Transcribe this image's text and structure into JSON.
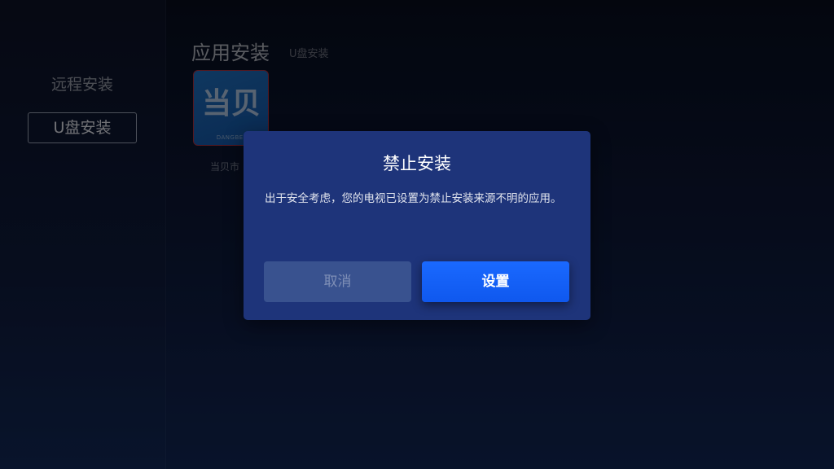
{
  "sidebar": {
    "items": [
      {
        "label": "远程安装",
        "selected": false
      },
      {
        "label": "U盘安装",
        "selected": true
      }
    ]
  },
  "main": {
    "title": "应用安装",
    "subtitle": "U盘安装",
    "apps": [
      {
        "name": "当贝市",
        "icon_text": "当贝",
        "icon_caption": "DANGBEI"
      }
    ]
  },
  "dialog": {
    "title": "禁止安装",
    "message": "出于安全考虑，您的电视已设置为禁止安装来源不明的应用。",
    "cancel_label": "取消",
    "settings_label": "设置"
  },
  "colors": {
    "dialog_bg": "#1e347a",
    "primary_button": "#1a69ff",
    "cancel_button": "#39528f"
  }
}
